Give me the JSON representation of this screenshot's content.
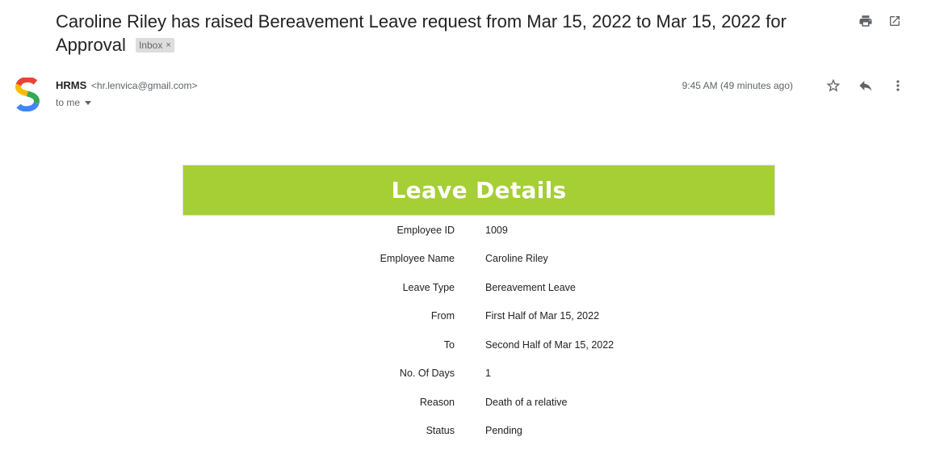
{
  "email": {
    "subject": "Caroline Riley has raised Bereavement Leave request from Mar 15, 2022 to Mar 15, 2022 for Approval",
    "label_chip": "Inbox",
    "label_chip_close": "×",
    "sender_name": "HRMS",
    "sender_email": "<hr.lenvica@gmail.com>",
    "recipient": "to me",
    "timestamp": "9:45 AM (49 minutes ago)",
    "icons": [
      "print-icon",
      "open-in-new-window-icon",
      "star-icon",
      "reply-icon",
      "more-vert-icon"
    ]
  },
  "leave": {
    "title": "Leave Details",
    "accent_color": "#a5cf35",
    "rows": [
      {
        "label": "Employee ID",
        "value": "1009"
      },
      {
        "label": "Employee Name",
        "value": "Caroline Riley"
      },
      {
        "label": "Leave Type",
        "value": "Bereavement Leave"
      },
      {
        "label": "From",
        "value": "First Half of Mar 15, 2022"
      },
      {
        "label": "To",
        "value": "Second Half of Mar 15, 2022"
      },
      {
        "label": "No. Of Days",
        "value": "1"
      },
      {
        "label": "Reason",
        "value": "Death of a relative"
      },
      {
        "label": "Status",
        "value": "Pending"
      }
    ]
  }
}
